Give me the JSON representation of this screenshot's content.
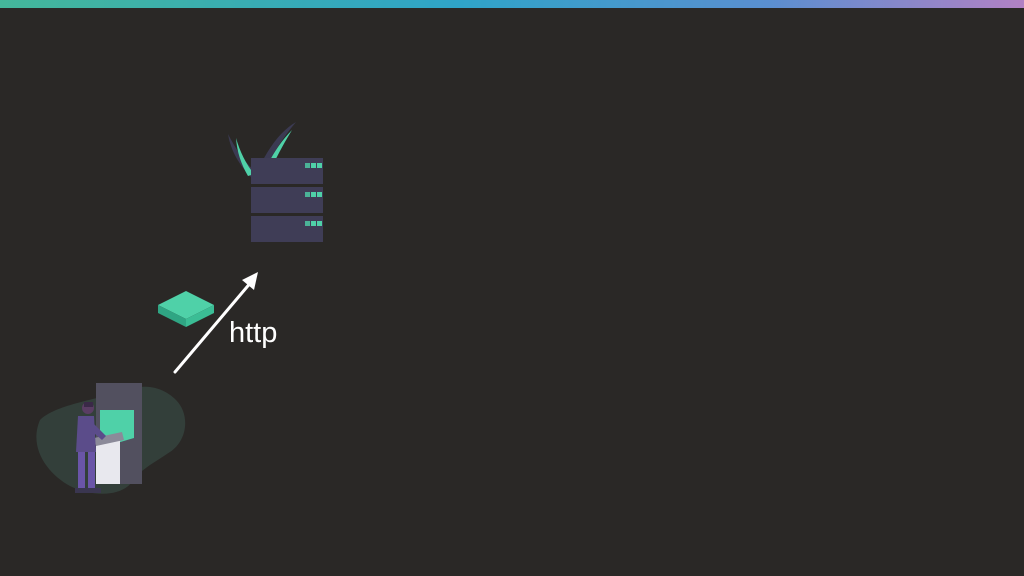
{
  "diagram": {
    "protocol_label": "http"
  },
  "colors": {
    "background": "#2a2826",
    "accent_green": "#4fd1a8",
    "server_body": "#3f3d56",
    "arrow": "#ffffff"
  }
}
